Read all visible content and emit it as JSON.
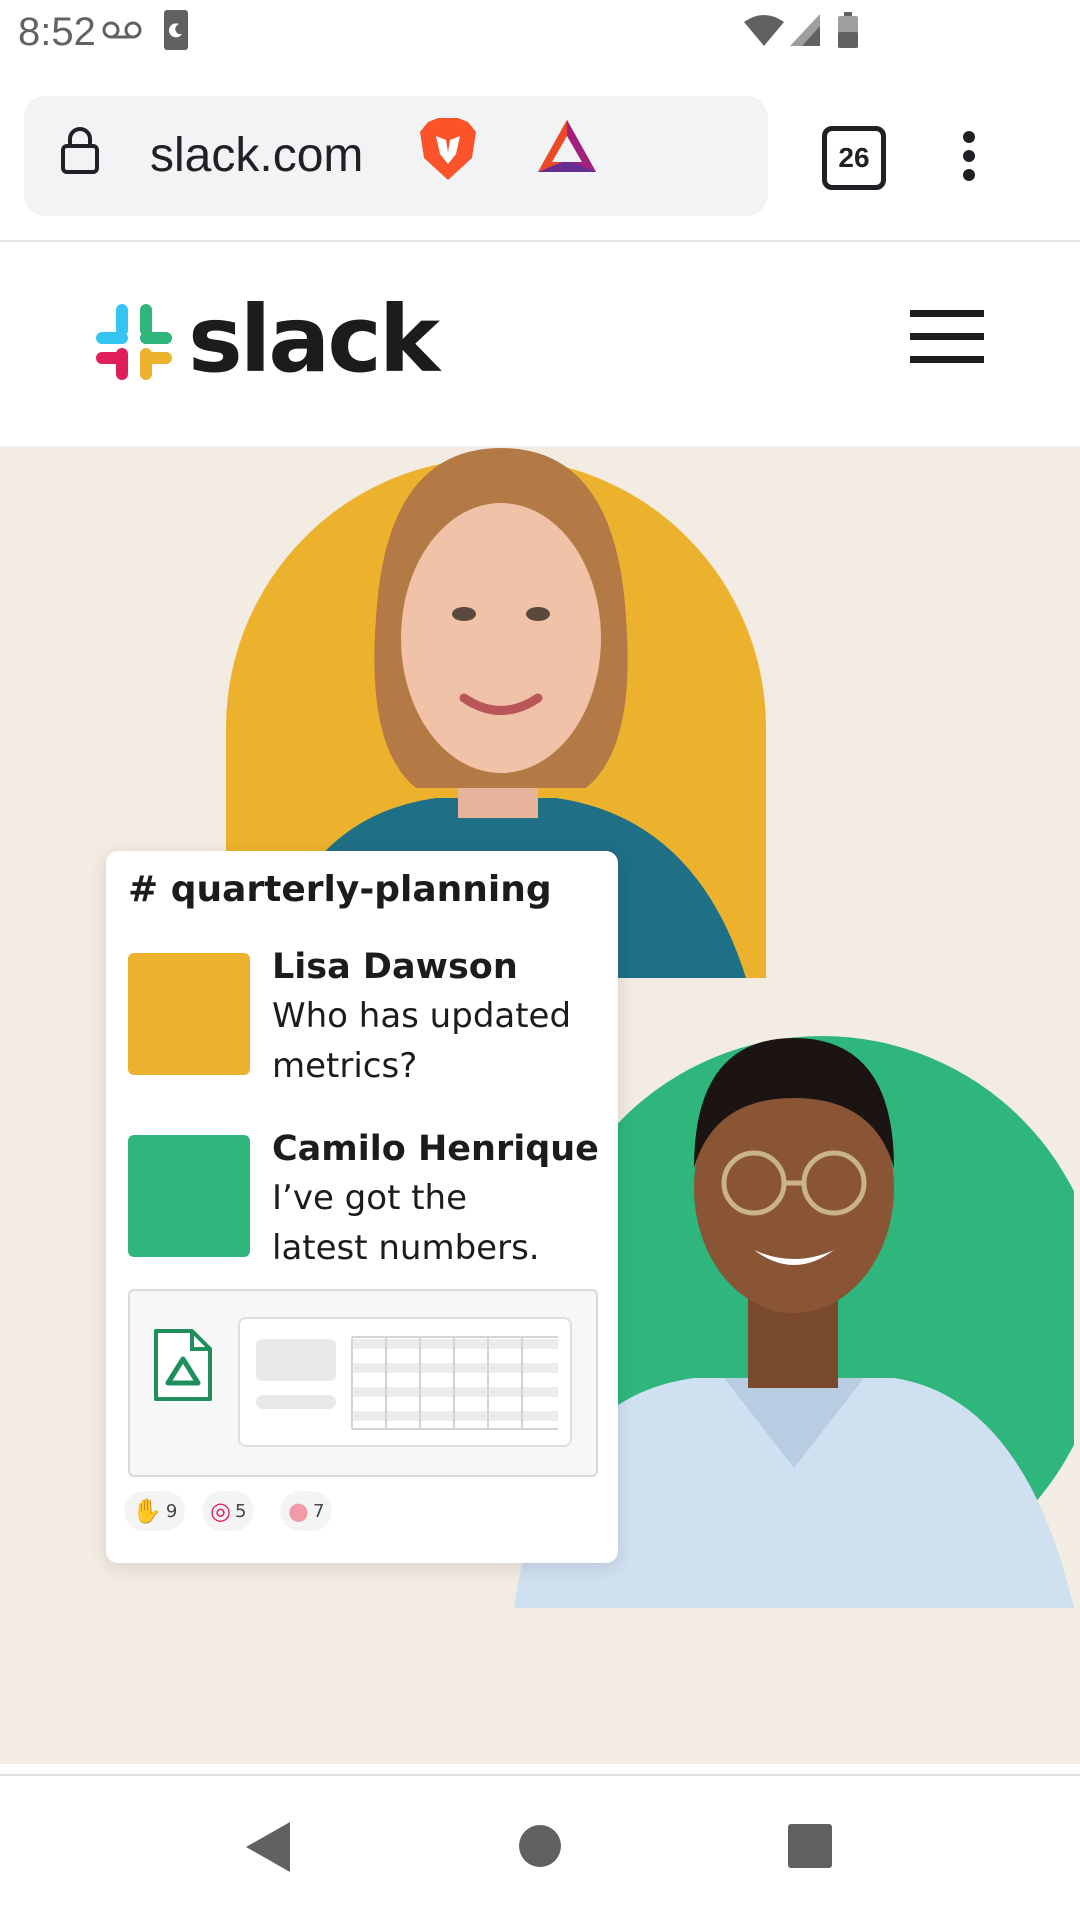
{
  "status_bar": {
    "time": "8:52",
    "icons": [
      "voicemail-icon",
      "do-not-disturb-icon",
      "wifi-icon",
      "signal-icon",
      "battery-icon"
    ]
  },
  "browser": {
    "url": "slack.com",
    "tab_count": "26",
    "icons": [
      "lock-icon",
      "brave-shield-icon",
      "brave-rewards-icon",
      "more-vert-icon"
    ]
  },
  "site": {
    "logo_text": "slack",
    "menu_icon": "hamburger-menu-icon"
  },
  "hero": {
    "colors": {
      "yellow": "#ecb22e",
      "green": "#2eb67d",
      "background": "#f4ede4"
    },
    "card": {
      "channel": "# quarterly-planning",
      "messages": [
        {
          "author": "Lisa Dawson",
          "text": "Who has updated metrics?",
          "avatar_color": "#ecb22e"
        },
        {
          "author": "Camilo Henrique",
          "text": "I’ve got the latest numbers.",
          "avatar_color": "#2eb67d"
        }
      ],
      "attachment_icon": "google-drive-file-icon",
      "reactions": [
        {
          "icon": "raised-hands-icon",
          "count": "9"
        },
        {
          "icon": "target-icon",
          "count": "5"
        },
        {
          "icon": "brain-icon",
          "count": "7"
        }
      ]
    }
  },
  "nav_bar": {
    "icons": [
      "back-icon",
      "home-icon",
      "recents-icon"
    ]
  }
}
